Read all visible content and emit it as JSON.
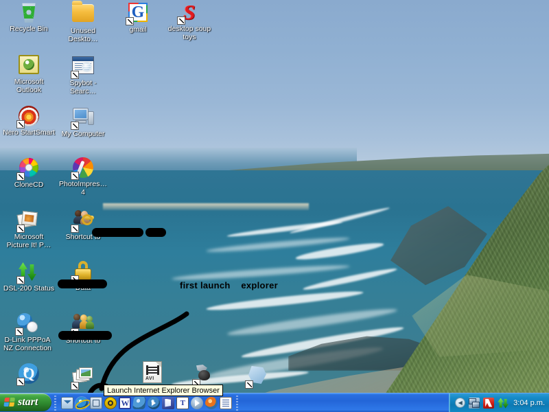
{
  "wallpaper": {
    "description": "coastal beach photograph with ocean waves, distant township on headland and green grassy hillside on the right",
    "sky_color": "#8fafd0",
    "ocean_color": "#2f7594",
    "headland_color": "#5e7749",
    "sand_color": "#c9b996"
  },
  "desktop": {
    "icons": [
      {
        "label": "Recycle Bin",
        "icon": "recycle-bin-icon",
        "shortcut": false,
        "redacted": false
      },
      {
        "label": "Unused Deskto…",
        "icon": "folder-icon",
        "shortcut": false,
        "redacted": false
      },
      {
        "label": "gmail",
        "icon": "gmail-icon",
        "shortcut": true,
        "redacted": false
      },
      {
        "label": "desktop soup toys",
        "icon": "desktop-soup-toys-icon",
        "shortcut": true,
        "redacted": false
      },
      {
        "label": "Microsoft Outlook",
        "icon": "microsoft-outlook-icon",
        "shortcut": false,
        "redacted": false
      },
      {
        "label": "Spybot - Searc…",
        "icon": "spybot-icon",
        "shortcut": true,
        "redacted": false
      },
      {
        "label": "Nero StartSmart",
        "icon": "nero-startsmart-icon",
        "shortcut": true,
        "redacted": false
      },
      {
        "label": "My Computer",
        "icon": "my-computer-icon",
        "shortcut": true,
        "redacted": false
      },
      {
        "label": "CloneCD",
        "icon": "clonecd-icon",
        "shortcut": true,
        "redacted": false
      },
      {
        "label": "PhotoImpres… 4",
        "icon": "photoimpression-icon",
        "shortcut": true,
        "redacted": false
      },
      {
        "label": "Microsoft Picture It! P…",
        "icon": "microsoft-picture-it-icon",
        "shortcut": true,
        "redacted": false
      },
      {
        "label": "Shortcut to",
        "icon": "shortcut-people-key-icon",
        "shortcut": true,
        "redacted": true
      },
      {
        "label": "DSL-200 Status",
        "icon": "dsl-200-status-icon",
        "shortcut": true,
        "redacted": false
      },
      {
        "label": "Data",
        "icon": "lock-icon",
        "shortcut": true,
        "redacted": true
      },
      {
        "label": "D-Link PPPoA NZ Connection",
        "icon": "d-link-connection-icon",
        "shortcut": true,
        "redacted": false
      },
      {
        "label": "Shortcut to",
        "icon": "shortcut-users-icon",
        "shortcut": true,
        "redacted": true
      },
      {
        "label": "",
        "icon": "quicktime-icon",
        "shortcut": true,
        "redacted": false
      },
      {
        "label": "",
        "icon": "photos-icon",
        "shortcut": true,
        "redacted": false
      },
      {
        "label": "",
        "icon": "avi-file-icon",
        "shortcut": false,
        "redacted": false
      },
      {
        "label": "",
        "icon": "tool-shortcut-icon",
        "shortcut": true,
        "redacted": false
      },
      {
        "label": "",
        "icon": "blue-item-shortcut-icon",
        "shortcut": true,
        "redacted": false
      }
    ]
  },
  "annotation": {
    "text": "first launch    explorer",
    "ink_color": "#000000",
    "description": "hand-drawn black line from the caption curving down to a circle around the Internet Explorer quick launch button"
  },
  "tooltip": {
    "text": "Launch Internet Explorer Browser"
  },
  "taskbar": {
    "start_label": "start",
    "quick_launch": [
      {
        "name": "internet-explorer",
        "title": "Launch Internet Explorer Browser"
      },
      {
        "name": "outlook-express",
        "title": "Launch Outlook Express"
      },
      {
        "name": "winamp",
        "title": "Winamp"
      },
      {
        "name": "microsoft-word",
        "title": "Microsoft Word"
      },
      {
        "name": "msn-messenger",
        "title": "MSN Messenger"
      },
      {
        "name": "media-player",
        "title": "Windows Media Player"
      },
      {
        "name": "office-shortcut",
        "title": "Microsoft Office"
      },
      {
        "name": "text-tool",
        "title": "Text Tool"
      },
      {
        "name": "real-player",
        "title": "RealPlayer"
      },
      {
        "name": "firefox",
        "title": "Mozilla Firefox"
      },
      {
        "name": "notepad",
        "title": "Notepad"
      }
    ],
    "tray": {
      "chevron": "◀",
      "icons": [
        {
          "name": "network-connection-icon"
        },
        {
          "name": "antivirus-shield-icon"
        },
        {
          "name": "network-activity-icon"
        }
      ],
      "clock": "3:04 p.m."
    }
  }
}
